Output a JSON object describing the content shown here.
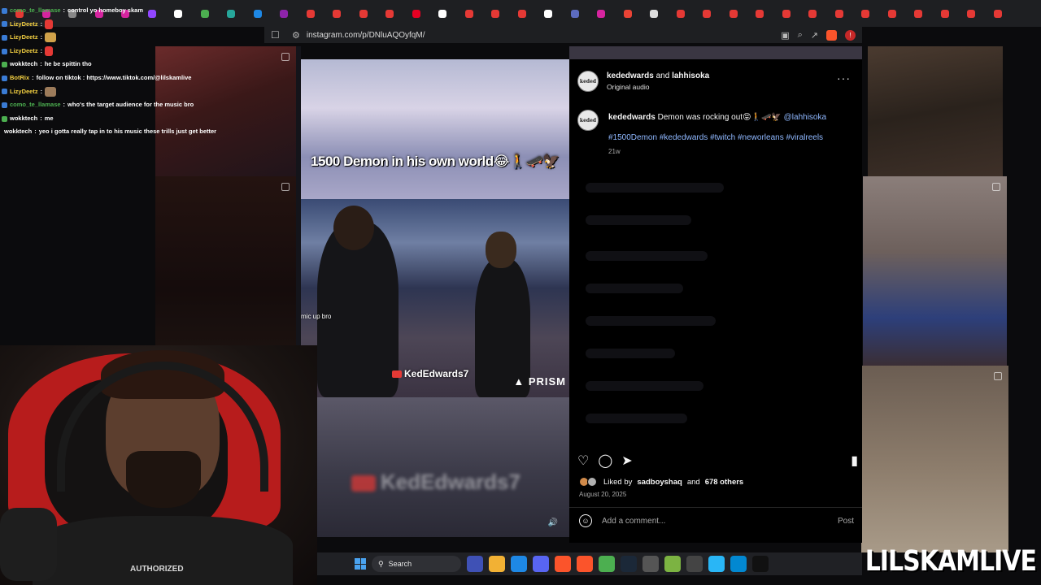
{
  "browser": {
    "tabs": [
      {
        "icon": "youtube-icon",
        "color": "#e53935"
      },
      {
        "icon": "instagram-icon",
        "color": "#d6249f"
      },
      {
        "icon": "close-icon",
        "color": "#888888"
      },
      {
        "icon": "instagram-icon",
        "color": "#d6249f"
      },
      {
        "icon": "instagram-icon",
        "color": "#d6249f"
      },
      {
        "icon": "twitch-icon",
        "color": "#9146ff"
      },
      {
        "icon": "x-icon",
        "color": "#ffffff"
      },
      {
        "icon": "chrome-icon",
        "color": "#4caf50"
      },
      {
        "icon": "app-icon",
        "color": "#26a69a"
      },
      {
        "icon": "shield-icon",
        "color": "#1e88e5"
      },
      {
        "icon": "app-icon",
        "color": "#8e24aa"
      },
      {
        "icon": "youtube-icon",
        "color": "#e53935"
      },
      {
        "icon": "youtube-icon",
        "color": "#e53935"
      },
      {
        "icon": "youtube-icon",
        "color": "#e53935"
      },
      {
        "icon": "youtube-icon",
        "color": "#e53935"
      },
      {
        "icon": "pinterest-icon",
        "color": "#e60023"
      },
      {
        "icon": "app-icon",
        "color": "#ffffff"
      },
      {
        "icon": "youtube-icon",
        "color": "#e53935"
      },
      {
        "icon": "youtube-icon",
        "color": "#e53935"
      },
      {
        "icon": "youtube-icon",
        "color": "#e53935"
      },
      {
        "icon": "x-icon",
        "color": "#ffffff"
      },
      {
        "icon": "app-icon",
        "color": "#5c6bc0"
      },
      {
        "icon": "instagram-icon",
        "color": "#d6249f"
      },
      {
        "icon": "gmail-icon",
        "color": "#ea4335"
      },
      {
        "icon": "settings-icon",
        "color": "#dddddd"
      },
      {
        "icon": "youtube-icon",
        "color": "#e53935"
      },
      {
        "icon": "youtube-icon",
        "color": "#e53935"
      },
      {
        "icon": "youtube-icon",
        "color": "#e53935"
      },
      {
        "icon": "youtube-icon",
        "color": "#e53935"
      },
      {
        "icon": "youtube-icon",
        "color": "#e53935"
      },
      {
        "icon": "youtube-icon",
        "color": "#e53935"
      },
      {
        "icon": "youtube-icon",
        "color": "#e53935"
      },
      {
        "icon": "youtube-icon",
        "color": "#e53935"
      },
      {
        "icon": "youtube-icon",
        "color": "#e53935"
      },
      {
        "icon": "youtube-icon",
        "color": "#e53935"
      },
      {
        "icon": "youtube-icon",
        "color": "#e53935"
      },
      {
        "icon": "youtube-icon",
        "color": "#e53935"
      },
      {
        "icon": "youtube-icon",
        "color": "#e53935"
      }
    ],
    "url": "instagram.com/p/DNluAQOyfqM/"
  },
  "chat": [
    {
      "user": "como_te_llamase",
      "user_color": "#4caf50",
      "msg": "control yo homeboy skam"
    },
    {
      "user": "LizyDeetz",
      "user_color": "#f5d142",
      "msg": "",
      "emote": "red"
    },
    {
      "user": "LizyDeetz",
      "user_color": "#f5d142",
      "msg": "",
      "emote": "gold"
    },
    {
      "user": "LizyDeetz",
      "user_color": "#f5d142",
      "msg": "",
      "emote": "red"
    },
    {
      "user": "wokktech",
      "user_color": "#ffffff",
      "msg": "he be spittin tho"
    },
    {
      "user": "BotRix",
      "user_color": "#f5d142",
      "msg": "follow on tiktok : https://www.tiktok.com/@lilskamlive"
    },
    {
      "user": "LizyDeetz",
      "user_color": "#f5d142",
      "msg": "",
      "emote": "skin"
    },
    {
      "user": "como_te_llamase",
      "user_color": "#4caf50",
      "msg": "who's the target audience for the music bro"
    },
    {
      "user": "wokktech",
      "user_color": "#ffffff",
      "msg": "me"
    },
    {
      "user": "wokktech",
      "user_color": "#ffffff",
      "msg": "yeo i gotta really tap in to his music these trills just get better"
    }
  ],
  "reel": {
    "title": "1500 Demon in his own world😂🚶🛹🦅",
    "mic_text": "mic up bro",
    "handle": "KedEdwards7",
    "prism": "PRISM",
    "blur_text": "KedEdwards7"
  },
  "post": {
    "author": "kededwards",
    "and_text": "and",
    "coauthor": "lahhisoka",
    "audio": "Original audio",
    "caption_user": "kededwards",
    "caption_text": "Demon was rocking out😝🚶🛹🦅",
    "caption_mention": "@lahhisoka",
    "hashtags": "#1500Demon #kededwards #twitch #neworleans #viralreels",
    "age": "21w",
    "likes_prefix": "Liked by",
    "liked_by": "sadboyshaq",
    "likes_and": "and",
    "likes_others": "678 others",
    "date": "August 20, 2025",
    "comment_placeholder": "Add a comment...",
    "post_label": "Post",
    "avatar_text": "keded"
  },
  "webcam": {
    "shirt_text": "AUTHORIZED"
  },
  "taskbar": {
    "search_label": "Search",
    "icons": [
      {
        "name": "copilot-icon",
        "color": "#3f51b5"
      },
      {
        "name": "file-explorer-icon",
        "color": "#f2b134"
      },
      {
        "name": "store-icon",
        "color": "#1e88e5"
      },
      {
        "name": "discord-icon",
        "color": "#5865f2"
      },
      {
        "name": "brave-icon",
        "color": "#fb542b"
      },
      {
        "name": "brave-active-icon",
        "color": "#fb542b"
      },
      {
        "name": "chrome-icon",
        "color": "#4caf50"
      },
      {
        "name": "steam-icon",
        "color": "#1b2838"
      },
      {
        "name": "app-icon",
        "color": "#555555"
      },
      {
        "name": "app-icon",
        "color": "#7cb342"
      },
      {
        "name": "app-icon",
        "color": "#444444"
      },
      {
        "name": "notepad-icon",
        "color": "#29b6f6"
      },
      {
        "name": "app-icon",
        "color": "#0288d1"
      },
      {
        "name": "capcut-icon",
        "color": "#111111"
      }
    ]
  },
  "watermark": "LILSKAMLIVE"
}
